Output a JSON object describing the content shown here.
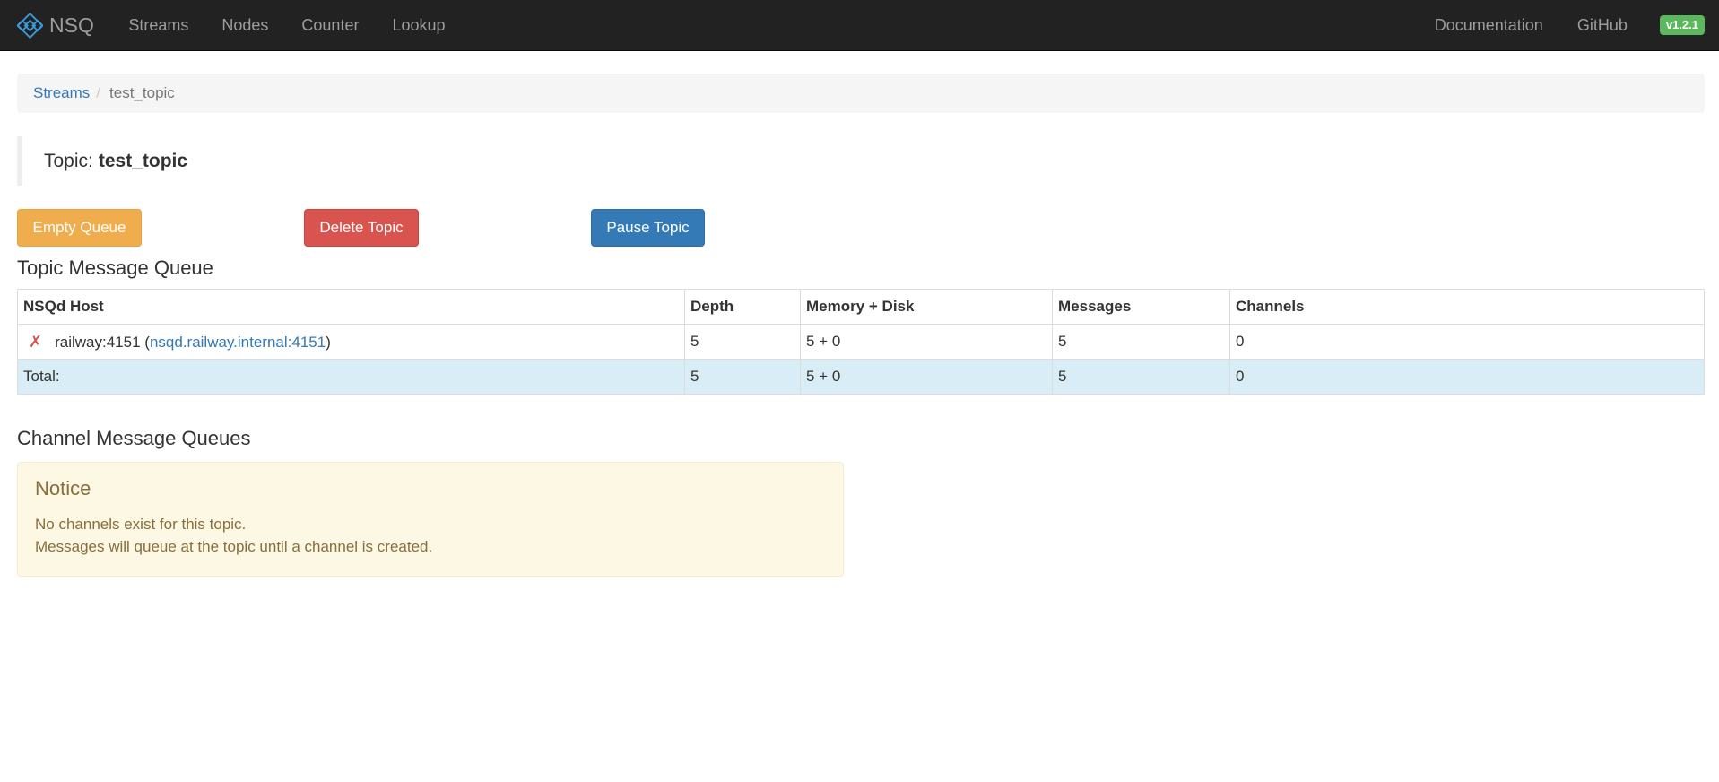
{
  "navbar": {
    "brand": "NSQ",
    "links": [
      "Streams",
      "Nodes",
      "Counter",
      "Lookup"
    ],
    "right_links": [
      "Documentation",
      "GitHub"
    ],
    "version": "v1.2.1"
  },
  "breadcrumb": {
    "parent": "Streams",
    "separator": "/",
    "current": "test_topic"
  },
  "topic": {
    "label": "Topic:",
    "name": "test_topic"
  },
  "actions": {
    "empty_queue": "Empty Queue",
    "delete_topic": "Delete Topic",
    "pause_topic": "Pause Topic"
  },
  "topic_queue": {
    "title": "Topic Message Queue",
    "columns": [
      "NSQd Host",
      "Depth",
      "Memory + Disk",
      "Messages",
      "Channels"
    ],
    "rows": [
      {
        "status_icon": "✗",
        "host": "railway:4151",
        "open_paren": "(",
        "address": "nsqd.railway.internal:4151",
        "close_paren": ")",
        "depth": "5",
        "memory_disk": "5 + 0",
        "messages": "5",
        "channels": "0"
      }
    ],
    "total": {
      "label": "Total:",
      "depth": "5",
      "memory_disk": "5 + 0",
      "messages": "5",
      "channels": "0"
    }
  },
  "channel_queues": {
    "title": "Channel Message Queues",
    "notice": {
      "heading": "Notice",
      "line1": "No channels exist for this topic.",
      "line2": "Messages will queue at the topic until a channel is created."
    }
  },
  "colors": {
    "navbar_bg": "#222222",
    "link": "#337ab7",
    "warning": "#f0ad4e",
    "danger": "#d9534f",
    "primary": "#337ab7",
    "success": "#5cb85c"
  },
  "icons": {
    "brand": "nsq-logo-icon",
    "host_status": "error-x-icon"
  }
}
